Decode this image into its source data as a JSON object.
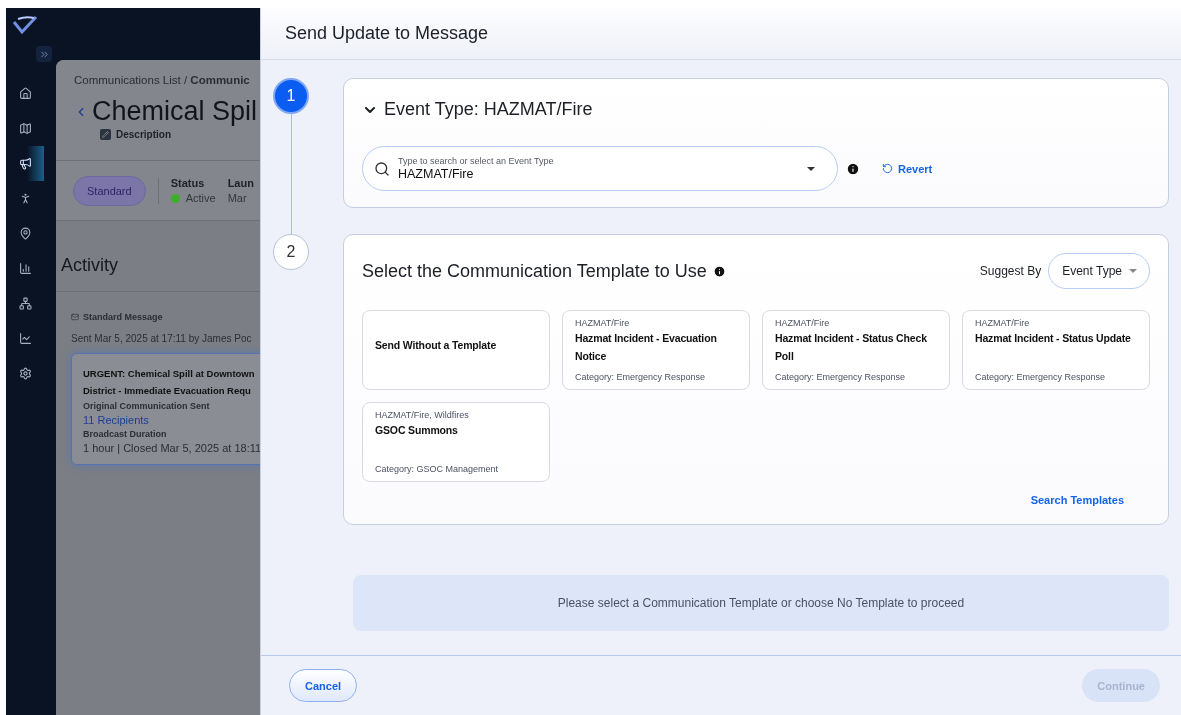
{
  "sidebar": {
    "items": [
      {
        "selected": false
      },
      {
        "selected": false
      },
      {
        "selected": true
      },
      {
        "selected": false
      },
      {
        "selected": false
      },
      {
        "selected": false
      },
      {
        "selected": false
      },
      {
        "selected": false
      },
      {
        "selected": false
      }
    ]
  },
  "background_page": {
    "breadcrumb": "Communications List / **Communic**",
    "title": "Chemical Spil",
    "description": "Description",
    "badge": "Standard",
    "status": {
      "label": "Status",
      "value": "Active",
      "color": "#3fae2a"
    },
    "launch_label": "Laun",
    "launch_value": "Mar",
    "section_title": "Activity",
    "message_type": "Standard Message",
    "sent_line": "Sent Mar 5, 2025 at 17:11 by James Poc",
    "card": {
      "title_lines": [
        "URGENT: Chemical Spill at Downtown",
        "District - Immediate Evacuation Requ"
      ],
      "sent_label": "Original Communication Sent",
      "recipients": "11 Recipients",
      "duration_label": "Broadcast Duration",
      "duration_value": "1 hour | Closed Mar 5, 2025 at 18:11"
    }
  },
  "modal": {
    "title": "Send Update to Message",
    "event_section": {
      "step": {
        "number": "1",
        "selected": true
      },
      "heading": "Event Type: HAZMAT/Fire",
      "expanded": true,
      "field": {
        "label": "Type to search or select an Event Type",
        "value": "HAZMAT/Fire"
      },
      "revert": "Revert"
    },
    "template_section": {
      "step": {
        "number": "2",
        "selected": false
      },
      "heading": "Select the Communication Template to Use",
      "suggest_label": "Suggest By",
      "suggest_value": "Event Type",
      "templates": [
        {
          "kind": "blank",
          "name": "Send Without a Template",
          "selected": false
        },
        {
          "kind": "template",
          "tags": "HAZMAT/Fire",
          "name": "Hazmat Incident - Evacuation Notice",
          "category": "Category: Emergency Response",
          "selected": false
        },
        {
          "kind": "template",
          "tags": "HAZMAT/Fire",
          "name": "Hazmat Incident - Status Check Poll",
          "category": "Category: Emergency Response",
          "selected": false
        },
        {
          "kind": "template",
          "tags": "HAZMAT/Fire",
          "name": "Hazmat Incident - Status Update",
          "category": "Category: Emergency Response",
          "selected": false
        },
        {
          "kind": "template",
          "tags": "HAZMAT/Fire, Wildfires",
          "name": "GSOC Summons",
          "category": "Category: GSOC Management",
          "selected": false
        }
      ],
      "search_link": "Search Templates"
    },
    "notice": "Please select a Communication Template or choose No Template to proceed",
    "buttons": {
      "cancel": "Cancel",
      "continue": {
        "label": "Continue",
        "disabled": true
      }
    }
  }
}
